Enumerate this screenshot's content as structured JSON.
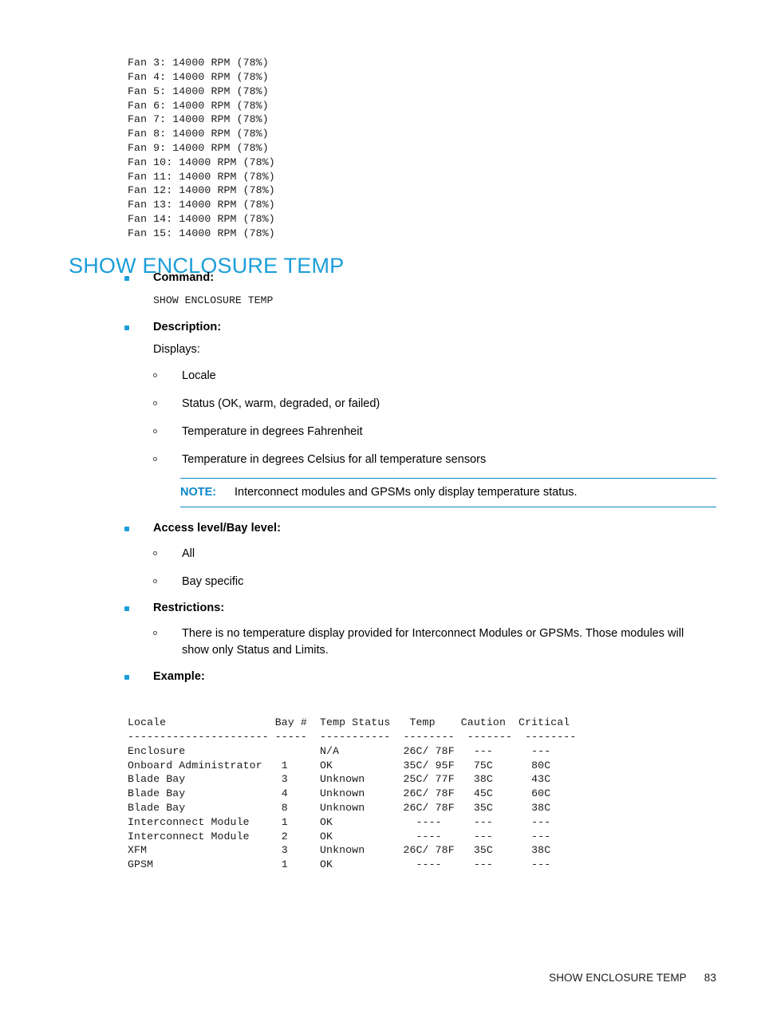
{
  "fan_block": {
    "lines": [
      "Fan 3: 14000 RPM (78%)",
      "Fan 4: 14000 RPM (78%)",
      "Fan 5: 14000 RPM (78%)",
      "Fan 6: 14000 RPM (78%)",
      "Fan 7: 14000 RPM (78%)",
      "Fan 8: 14000 RPM (78%)",
      "Fan 9: 14000 RPM (78%)",
      "Fan 10: 14000 RPM (78%)",
      "Fan 11: 14000 RPM (78%)",
      "Fan 12: 14000 RPM (78%)",
      "Fan 13: 14000 RPM (78%)",
      "Fan 14: 14000 RPM (78%)",
      "Fan 15: 14000 RPM (78%)"
    ]
  },
  "heading": "SHOW ENCLOSURE TEMP",
  "sections": {
    "command_label": "Command:",
    "command_value": "SHOW ENCLOSURE TEMP",
    "description_label": "Description:",
    "description_intro": "Displays:",
    "description_items": [
      "Locale",
      "Status (OK, warm, degraded, or failed)",
      "Temperature in degrees Fahrenheit",
      "Temperature in degrees Celsius for all temperature sensors"
    ],
    "note_label": "NOTE:",
    "note_text": "Interconnect modules and GPSMs only display temperature status.",
    "access_label": "Access level/Bay level:",
    "access_items": [
      "All",
      "Bay specific"
    ],
    "restrictions_label": "Restrictions:",
    "restrictions_items": [
      "There is no temperature display provided for Interconnect Modules or GPSMs. Those modules will show only Status and Limits."
    ],
    "example_label": "Example:"
  },
  "example_output": {
    "header": "Locale                 Bay #  Temp Status   Temp    Caution  Critical",
    "separator": "---------------------- -----  -----------  --------  -------  --------",
    "rows": [
      "Enclosure                     N/A          26C/ 78F   ---      ---",
      "Onboard Administrator   1     OK           35C/ 95F   75C      80C",
      "Blade Bay               3     Unknown      25C/ 77F   38C      43C",
      "Blade Bay               4     Unknown      26C/ 78F   45C      60C",
      "Blade Bay               8     Unknown      26C/ 78F   35C      38C",
      "Interconnect Module     1     OK             ----     ---      ---",
      "Interconnect Module     2     OK             ----     ---      ---",
      "XFM                     3     Unknown      26C/ 78F   35C      38C",
      "GPSM                    1     OK             ----     ---      ---"
    ],
    "columns": [
      "Locale",
      "Bay #",
      "Temp Status",
      "Temp",
      "Caution",
      "Critical"
    ],
    "records": [
      {
        "locale": "Enclosure",
        "bay": "",
        "status": "N/A",
        "temp": "26C/ 78F",
        "caution": "---",
        "critical": "---"
      },
      {
        "locale": "Onboard Administrator",
        "bay": "1",
        "status": "OK",
        "temp": "35C/ 95F",
        "caution": "75C",
        "critical": "80C"
      },
      {
        "locale": "Blade Bay",
        "bay": "3",
        "status": "Unknown",
        "temp": "25C/ 77F",
        "caution": "38C",
        "critical": "43C"
      },
      {
        "locale": "Blade Bay",
        "bay": "4",
        "status": "Unknown",
        "temp": "26C/ 78F",
        "caution": "45C",
        "critical": "60C"
      },
      {
        "locale": "Blade Bay",
        "bay": "8",
        "status": "Unknown",
        "temp": "26C/ 78F",
        "caution": "35C",
        "critical": "38C"
      },
      {
        "locale": "Interconnect Module",
        "bay": "1",
        "status": "OK",
        "temp": "----",
        "caution": "---",
        "critical": "---"
      },
      {
        "locale": "Interconnect Module",
        "bay": "2",
        "status": "OK",
        "temp": "----",
        "caution": "---",
        "critical": "---"
      },
      {
        "locale": "XFM",
        "bay": "3",
        "status": "Unknown",
        "temp": "26C/ 78F",
        "caution": "35C",
        "critical": "38C"
      },
      {
        "locale": "GPSM",
        "bay": "1",
        "status": "OK",
        "temp": "----",
        "caution": "---",
        "critical": "---"
      }
    ]
  },
  "footer": {
    "title": "SHOW ENCLOSURE TEMP",
    "page": "83"
  },
  "colors": {
    "accent": "#1b9dd9",
    "note_rule": "#0b86c8",
    "text": "#1a1a1a"
  }
}
